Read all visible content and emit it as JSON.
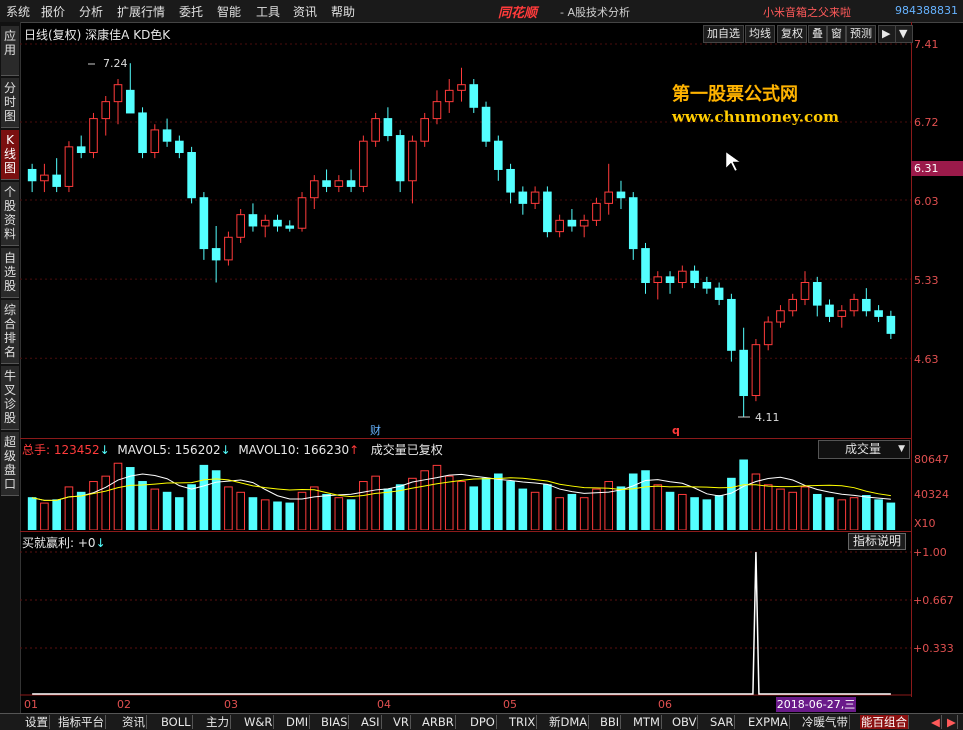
{
  "menu": [
    "系统",
    "报价",
    "分析",
    "扩展行情",
    "委托",
    "智能",
    "工具",
    "资讯",
    "帮助"
  ],
  "brand": "同花顺",
  "app_subtitle": "- A股技术分析",
  "user_name": "小米音箱之父来啦",
  "user_id": "984388831",
  "left_tabs": [
    {
      "label": "应用"
    },
    {
      "label": "分时图"
    },
    {
      "label": "K线图"
    },
    {
      "label": "个股资料"
    },
    {
      "label": "自选股"
    },
    {
      "label": "综合排名"
    },
    {
      "label": "牛叉诊股"
    },
    {
      "label": "超级盘口"
    }
  ],
  "chart_title": "日线(复权)  深康佳A  KD色K",
  "toolbar": [
    "加自选",
    "均线",
    "复权",
    "叠",
    "窗",
    "预测"
  ],
  "current_price": "6.31",
  "price_ticks": [
    "7.41",
    "6.72",
    "6.03",
    "5.33",
    "4.63"
  ],
  "high_label": "7.24",
  "low_label": "4.11",
  "marker_cai": "财",
  "marker_q": "q",
  "watermark_title": "第一股票公式网",
  "watermark_url": "www.chnmoney.com",
  "volume": {
    "total_label": "总手: 123452",
    "mavol5": "MAVOL5: 156202",
    "mavol10": "MAVOL10: 166230",
    "adjusted_note": "成交量已复权",
    "dropdown": "成交量",
    "ticks": [
      "80647",
      "40324",
      "X10"
    ]
  },
  "indicator": {
    "label": "买就赢利: +0",
    "explain_button": "指标说明",
    "ticks": [
      "+1.00",
      "+0.667",
      "+0.333"
    ]
  },
  "months": [
    "01",
    "02",
    "03",
    "04",
    "05",
    "06"
  ],
  "date_badge": "2018-06-27,三",
  "bottom_tabs": [
    "设置",
    "指标平台",
    "资讯",
    "BOLL",
    "主力",
    "W&R",
    "DMI",
    "BIAS",
    "ASI",
    "VR",
    "ARBR",
    "DPO",
    "TRIX",
    "新DMA",
    "BBI",
    "MTM",
    "OBV",
    "SAR",
    "EXPMA",
    "冷暖气带",
    "能百组合"
  ],
  "colors": {
    "up": "#ff3b3b",
    "down": "#54ffff",
    "axis": "#8b1a1a",
    "accent": "#ffb300"
  },
  "chart_data": {
    "type": "candlestick",
    "price_range": [
      4.11,
      7.41
    ],
    "candles": [
      [
        6.3,
        6.35,
        6.1,
        6.2
      ],
      [
        6.2,
        6.35,
        6.1,
        6.25
      ],
      [
        6.25,
        6.4,
        6.1,
        6.15
      ],
      [
        6.15,
        6.55,
        6.1,
        6.5
      ],
      [
        6.5,
        6.6,
        6.4,
        6.45
      ],
      [
        6.45,
        6.8,
        6.4,
        6.75
      ],
      [
        6.75,
        6.95,
        6.6,
        6.9
      ],
      [
        6.9,
        7.1,
        6.7,
        7.05
      ],
      [
        7.0,
        7.24,
        6.85,
        6.8
      ],
      [
        6.8,
        6.85,
        6.4,
        6.45
      ],
      [
        6.45,
        6.7,
        6.4,
        6.65
      ],
      [
        6.65,
        6.75,
        6.5,
        6.55
      ],
      [
        6.55,
        6.6,
        6.4,
        6.45
      ],
      [
        6.45,
        6.5,
        6.0,
        6.05
      ],
      [
        6.05,
        6.1,
        5.5,
        5.6
      ],
      [
        5.6,
        5.8,
        5.3,
        5.5
      ],
      [
        5.5,
        5.75,
        5.45,
        5.7
      ],
      [
        5.7,
        5.95,
        5.65,
        5.9
      ],
      [
        5.9,
        6.0,
        5.75,
        5.8
      ],
      [
        5.8,
        5.9,
        5.7,
        5.85
      ],
      [
        5.85,
        5.9,
        5.75,
        5.8
      ],
      [
        5.8,
        5.85,
        5.75,
        5.78
      ],
      [
        5.78,
        6.1,
        5.75,
        6.05
      ],
      [
        6.05,
        6.25,
        5.95,
        6.2
      ],
      [
        6.2,
        6.3,
        6.1,
        6.15
      ],
      [
        6.15,
        6.25,
        6.1,
        6.2
      ],
      [
        6.2,
        6.3,
        6.1,
        6.15
      ],
      [
        6.15,
        6.6,
        6.1,
        6.55
      ],
      [
        6.55,
        6.8,
        6.5,
        6.75
      ],
      [
        6.75,
        6.85,
        6.55,
        6.6
      ],
      [
        6.6,
        6.65,
        6.1,
        6.2
      ],
      [
        6.2,
        6.6,
        6.0,
        6.55
      ],
      [
        6.55,
        6.8,
        6.5,
        6.75
      ],
      [
        6.75,
        7.0,
        6.7,
        6.9
      ],
      [
        6.9,
        7.1,
        6.8,
        7.0
      ],
      [
        7.0,
        7.2,
        6.9,
        7.05
      ],
      [
        7.05,
        7.1,
        6.8,
        6.85
      ],
      [
        6.85,
        6.9,
        6.5,
        6.55
      ],
      [
        6.55,
        6.6,
        6.2,
        6.3
      ],
      [
        6.3,
        6.35,
        6.0,
        6.1
      ],
      [
        6.1,
        6.15,
        5.9,
        6.0
      ],
      [
        6.0,
        6.15,
        5.95,
        6.1
      ],
      [
        6.1,
        6.15,
        5.7,
        5.75
      ],
      [
        5.75,
        5.9,
        5.7,
        5.85
      ],
      [
        5.85,
        5.95,
        5.75,
        5.8
      ],
      [
        5.8,
        5.9,
        5.7,
        5.85
      ],
      [
        5.85,
        6.05,
        5.8,
        6.0
      ],
      [
        6.0,
        6.35,
        5.9,
        6.1
      ],
      [
        6.1,
        6.2,
        5.95,
        6.05
      ],
      [
        6.05,
        6.1,
        5.5,
        5.6
      ],
      [
        5.6,
        5.65,
        5.2,
        5.3
      ],
      [
        5.3,
        5.4,
        5.15,
        5.35
      ],
      [
        5.35,
        5.4,
        5.2,
        5.3
      ],
      [
        5.3,
        5.45,
        5.25,
        5.4
      ],
      [
        5.4,
        5.45,
        5.25,
        5.3
      ],
      [
        5.3,
        5.35,
        5.2,
        5.25
      ],
      [
        5.25,
        5.3,
        5.1,
        5.15
      ],
      [
        5.15,
        5.2,
        4.6,
        4.7
      ],
      [
        4.7,
        4.9,
        4.11,
        4.3
      ],
      [
        4.3,
        4.8,
        4.25,
        4.75
      ],
      [
        4.75,
        5.0,
        4.7,
        4.95
      ],
      [
        4.95,
        5.1,
        4.9,
        5.05
      ],
      [
        5.05,
        5.2,
        5.0,
        5.15
      ],
      [
        5.15,
        5.4,
        5.1,
        5.3
      ],
      [
        5.3,
        5.35,
        5.0,
        5.1
      ],
      [
        5.1,
        5.15,
        4.95,
        5.0
      ],
      [
        5.0,
        5.1,
        4.9,
        5.05
      ],
      [
        5.05,
        5.2,
        5.0,
        5.15
      ],
      [
        5.15,
        5.25,
        5.0,
        5.05
      ],
      [
        5.05,
        5.1,
        4.95,
        5.0
      ],
      [
        5.0,
        5.05,
        4.8,
        4.85
      ]
    ],
    "volume_range": [
      0,
      80647
    ],
    "volumes": [
      30,
      25,
      28,
      40,
      35,
      45,
      50,
      62,
      58,
      45,
      38,
      35,
      30,
      42,
      60,
      55,
      40,
      35,
      30,
      28,
      26,
      25,
      35,
      40,
      33,
      30,
      28,
      45,
      50,
      38,
      42,
      48,
      55,
      60,
      50,
      45,
      40,
      48,
      52,
      45,
      38,
      35,
      42,
      30,
      33,
      30,
      38,
      45,
      40,
      52,
      55,
      42,
      35,
      33,
      30,
      28,
      32,
      48,
      65,
      52,
      42,
      38,
      35,
      40,
      33,
      30,
      28,
      30,
      32,
      28,
      25
    ],
    "indicator_range": [
      0,
      1
    ],
    "indicator_signal_index": 59
  }
}
